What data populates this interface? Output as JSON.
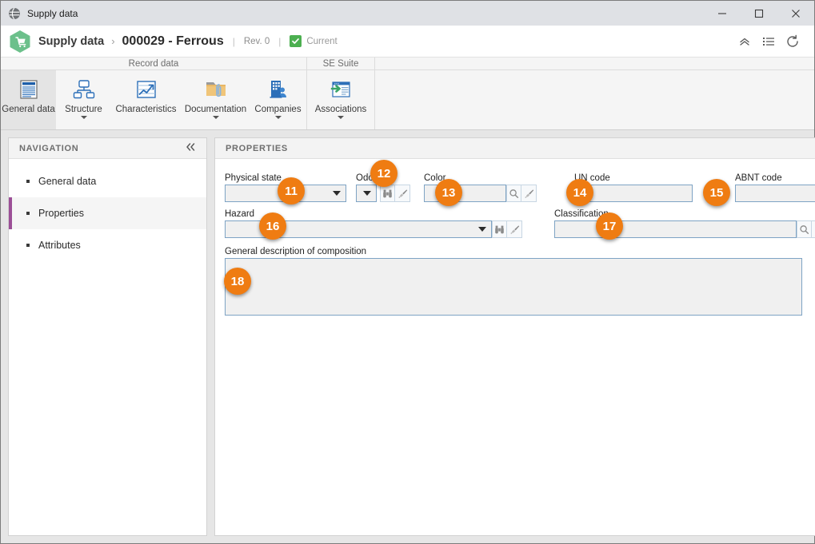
{
  "titlebar": {
    "title": "Supply data",
    "icon": "globe-icon",
    "minimize": "minimize-icon",
    "maximize": "maximize-icon",
    "close": "close-icon"
  },
  "header": {
    "app_icon": "supply-hexagon-icon",
    "breadcrumb_root": "Supply data",
    "breadcrumb_separator": "›",
    "record_title": "000029 - Ferrous",
    "divider": "|",
    "revision": "Rev. 0",
    "status": "Current",
    "status_color": "#4caf50",
    "actions": [
      {
        "name": "collapse-icon",
        "label": "collapse"
      },
      {
        "name": "list-icon",
        "label": "list"
      },
      {
        "name": "refresh-icon",
        "label": "refresh"
      }
    ]
  },
  "ribbon": {
    "groups": [
      {
        "title": "Record data",
        "items": [
          {
            "label": "General data",
            "icon": "document-lines-icon",
            "active": true,
            "caret": false
          },
          {
            "label": "Structure",
            "icon": "hierarchy-icon",
            "active": false,
            "caret": true
          },
          {
            "label": "Characteristics",
            "icon": "chart-trend-icon",
            "active": false,
            "caret": false
          },
          {
            "label": "Documentation",
            "icon": "folder-clip-icon",
            "active": false,
            "caret": true
          },
          {
            "label": "Companies",
            "icon": "building-people-icon",
            "active": false,
            "caret": true
          }
        ]
      },
      {
        "title": "SE Suite",
        "items": [
          {
            "label": "Associations",
            "icon": "window-arrow-icon",
            "active": false,
            "caret": true
          }
        ]
      }
    ]
  },
  "navigation": {
    "header": "NAVIGATION",
    "collapse_icon": "double-chevron-left-icon",
    "items": [
      {
        "label": "General data",
        "selected": false
      },
      {
        "label": "Properties",
        "selected": true
      },
      {
        "label": "Attributes",
        "selected": false
      }
    ],
    "selected_accent": "#9b4f96"
  },
  "properties": {
    "header": "PROPERTIES",
    "fields": {
      "physical_state": {
        "label": "Physical state",
        "value": "",
        "type": "select"
      },
      "odor": {
        "label": "Odor",
        "value": "",
        "type": "select-with-buttons"
      },
      "color": {
        "label": "Color",
        "value": "",
        "type": "lookup"
      },
      "un_code": {
        "label": "UN code",
        "value": "",
        "type": "text"
      },
      "abnt_code": {
        "label": "ABNT code",
        "value": "",
        "type": "text"
      },
      "hazard": {
        "label": "Hazard",
        "value": "",
        "type": "select-with-buttons"
      },
      "classification": {
        "label": "Classification",
        "value": "",
        "type": "lookup"
      },
      "description": {
        "label": "General description of composition",
        "value": "",
        "type": "textarea"
      }
    },
    "field_icons": {
      "binoculars": "binoculars-icon",
      "brush": "brush-icon",
      "magnifier": "magnifier-icon"
    }
  },
  "badges": {
    "color": "#ef7c12",
    "items": [
      {
        "number": "11",
        "target": "physical-state-field"
      },
      {
        "number": "12",
        "target": "odor-field"
      },
      {
        "number": "13",
        "target": "color-field"
      },
      {
        "number": "14",
        "target": "un-code-field"
      },
      {
        "number": "15",
        "target": "abnt-code-field"
      },
      {
        "number": "16",
        "target": "hazard-field"
      },
      {
        "number": "17",
        "target": "classification-field"
      },
      {
        "number": "18",
        "target": "description-field"
      }
    ]
  }
}
